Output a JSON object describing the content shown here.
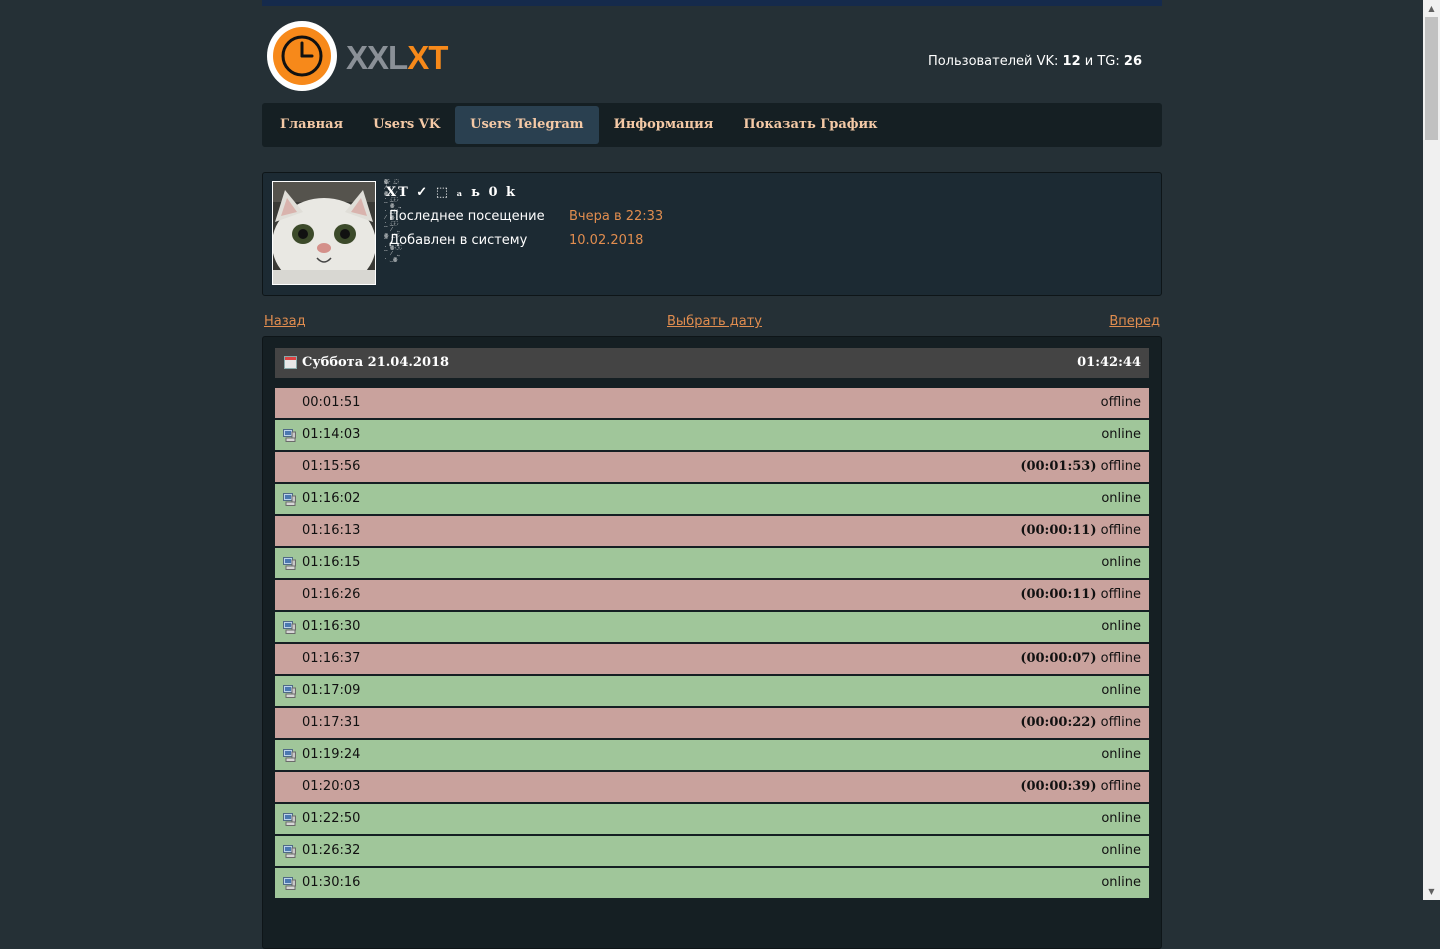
{
  "app": {
    "logo_part1": "XXL",
    "logo_part2": "XT",
    "users_prefix": "Пользователей VK:",
    "vk_count": "12",
    "and_tg": "и TG:",
    "tg_count": "26"
  },
  "nav": {
    "items": [
      {
        "label": "Главная"
      },
      {
        "label": "Users VK"
      },
      {
        "label": "Users Telegram"
      },
      {
        "label": "Информация"
      },
      {
        "label": "Показать График"
      }
    ],
    "active_index": 2
  },
  "profile": {
    "name": "XT ✓ ⬚ ₐ ь 0 k",
    "last_seen_label": "Последнее посещение",
    "last_seen_value": "Вчера в 22:33",
    "added_label": "Добавлен в систему",
    "added_value": "10.02.2018"
  },
  "datenav": {
    "back": "Назад",
    "pick": "Выбрать дату",
    "forward": "Вперед"
  },
  "day": {
    "date": "Суббота 21.04.2018",
    "total": "01:42:44"
  },
  "entries": [
    {
      "time": "00:01:51",
      "status": "offline",
      "duration": "",
      "icon": ""
    },
    {
      "time": "01:14:03",
      "status": "online",
      "duration": "",
      "icon": "pc-icon"
    },
    {
      "time": "01:15:56",
      "status": "offline",
      "duration": "(00:01:53)",
      "icon": ""
    },
    {
      "time": "01:16:02",
      "status": "online",
      "duration": "",
      "icon": "pc-icon"
    },
    {
      "time": "01:16:13",
      "status": "offline",
      "duration": "(00:00:11)",
      "icon": ""
    },
    {
      "time": "01:16:15",
      "status": "online",
      "duration": "",
      "icon": "pc-icon"
    },
    {
      "time": "01:16:26",
      "status": "offline",
      "duration": "(00:00:11)",
      "icon": ""
    },
    {
      "time": "01:16:30",
      "status": "online",
      "duration": "",
      "icon": "pc-icon"
    },
    {
      "time": "01:16:37",
      "status": "offline",
      "duration": "(00:00:07)",
      "icon": ""
    },
    {
      "time": "01:17:09",
      "status": "online",
      "duration": "",
      "icon": "pc-icon"
    },
    {
      "time": "01:17:31",
      "status": "offline",
      "duration": "(00:00:22)",
      "icon": ""
    },
    {
      "time": "01:19:24",
      "status": "online",
      "duration": "",
      "icon": "pc-icon"
    },
    {
      "time": "01:20:03",
      "status": "offline",
      "duration": "(00:00:39)",
      "icon": ""
    },
    {
      "time": "01:22:50",
      "status": "online",
      "duration": "",
      "icon": "pc-icon"
    },
    {
      "time": "01:26:32",
      "status": "online",
      "duration": "",
      "icon": "pc-icon"
    },
    {
      "time": "01:30:16",
      "status": "online",
      "duration": "",
      "icon": "pc-icon"
    }
  ],
  "colors": {
    "accent": "#f7891a",
    "link": "#e18d4f",
    "online_row": "#a0c69a",
    "offline_row": "#c9a29d"
  }
}
